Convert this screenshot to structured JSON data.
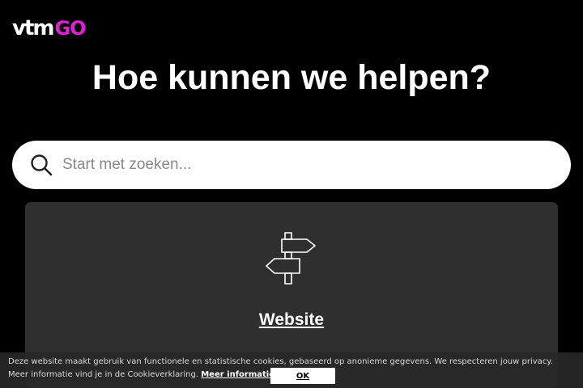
{
  "header": {
    "logo_text_main": "vtm",
    "logo_text_accent": "GO",
    "accent_color": "#e020d8"
  },
  "hero": {
    "title": "Hoe kunnen we helpen?"
  },
  "search": {
    "placeholder": "Start met zoeken...",
    "value": "",
    "icon": "search-icon"
  },
  "card": {
    "icon": "signpost-icon",
    "title": "Website"
  },
  "cookie_banner": {
    "text_part1": "Deze website maakt gebruik van functionele en statistische cookies, gebaseerd op anonieme gegevens. We respecteren jouw privacy. Meer informatie vind je in de Cookieverklaring.",
    "link_label": "Meer informatie",
    "text_part2": ".",
    "ok_label": "OK"
  }
}
